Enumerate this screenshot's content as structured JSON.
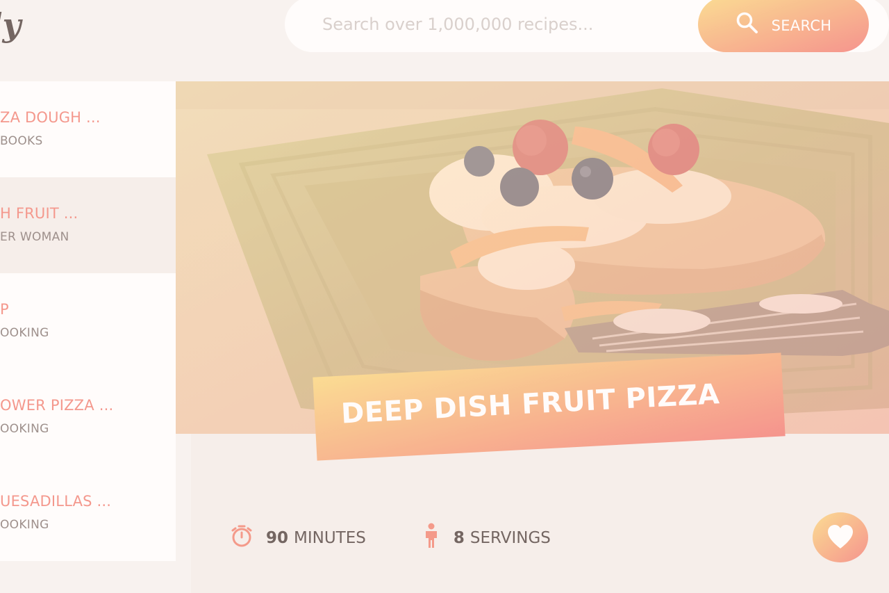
{
  "app": {
    "logo_text": "ly"
  },
  "search": {
    "placeholder": "Search over 1,000,000 recipes...",
    "value": "",
    "button_label": "SEARCH",
    "icon": "search-icon"
  },
  "results": [
    {
      "title": "ZA DOUGH ...",
      "publisher": "BOOKS",
      "active": false
    },
    {
      "title": "H FRUIT ...",
      "publisher": "ER WOMAN",
      "active": true
    },
    {
      "title": "P",
      "publisher": "OOKING",
      "active": false
    },
    {
      "title": "OWER PIZZA ...",
      "publisher": "OOKING",
      "active": false
    },
    {
      "title": "UESADILLAS ...",
      "publisher": "OOKING",
      "active": false
    }
  ],
  "recipe": {
    "title": "DEEP DISH FRUIT PIZZA",
    "cook_time_value": "90",
    "cook_time_unit": "MINUTES",
    "servings_value": "8",
    "servings_unit": "SERVINGS",
    "time_icon": "stopwatch-icon",
    "servings_icon": "person-icon",
    "bookmark_icon": "heart-icon"
  },
  "colors": {
    "accent_start": "#fbdb89",
    "accent_end": "#f48982",
    "text_main": "#615551",
    "result_title": "#f38e82",
    "background": "#f8f4f2"
  }
}
